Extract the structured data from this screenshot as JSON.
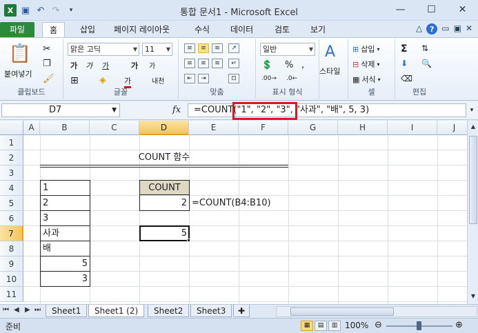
{
  "window": {
    "title": "통합 문서1  -  Microsoft Excel",
    "app_icon": "X",
    "controls": [
      "minimize-icon",
      "maximize-icon",
      "close-icon"
    ]
  },
  "ribbon_tabs": [
    "파일",
    "홈",
    "삽입",
    "페이지 레이아웃",
    "수식",
    "데이터",
    "검토",
    "보기"
  ],
  "ribbon": {
    "clipboard": {
      "paste": "붙여넣기",
      "label": "클립보드"
    },
    "font": {
      "name": "맑은 고딕",
      "size": "11",
      "label": "글꼴",
      "bold": "가",
      "italic": "가",
      "underline": "가",
      "grow": "가",
      "shrink": "가",
      "font_color": "가",
      "phonetic": "내천"
    },
    "alignment": {
      "label": "맞춤"
    },
    "number": {
      "format": "일반",
      "label": "표시 형식",
      "percent": "%",
      "comma": ","
    },
    "styles": {
      "label": "스타일"
    },
    "cells": {
      "insert": "삽입",
      "delete": "삭제",
      "format": "서식",
      "label": "셀"
    },
    "editing": {
      "label": "편집",
      "sum": "Σ"
    }
  },
  "formula_bar": {
    "name_box": "D7",
    "fx": "fx",
    "formula": "=COUNT(\"1\", \"2\", \"3\", \"사과\", \"배\", 5, 3)"
  },
  "columns": [
    "A",
    "B",
    "C",
    "D",
    "E",
    "F",
    "G",
    "H",
    "I",
    "J"
  ],
  "rows": [
    "1",
    "2",
    "3",
    "4",
    "5",
    "6",
    "7",
    "8",
    "9",
    "10",
    "11"
  ],
  "selected_cell": {
    "column": "D",
    "row": "7"
  },
  "cells": {
    "C2": "COUNT 함수",
    "B4": "1",
    "B5": "2",
    "B6": "3",
    "B7": "사과",
    "B8": "배",
    "B9": "5",
    "B10": "3",
    "D4": "COUNT",
    "D5": "2",
    "E5": "=COUNT(B4:B10)",
    "D7": "5"
  },
  "sheets": [
    "Sheet1",
    "Sheet1 (2)",
    "Sheet2",
    "Sheet3"
  ],
  "active_sheet": "Sheet1 (2)",
  "status": {
    "ready": "준비",
    "zoom": "100%"
  },
  "colors": {
    "highlight_box": "#e0141e",
    "file_tab": "#2b8a3e",
    "count_header_fill": "#ddd9c4"
  }
}
